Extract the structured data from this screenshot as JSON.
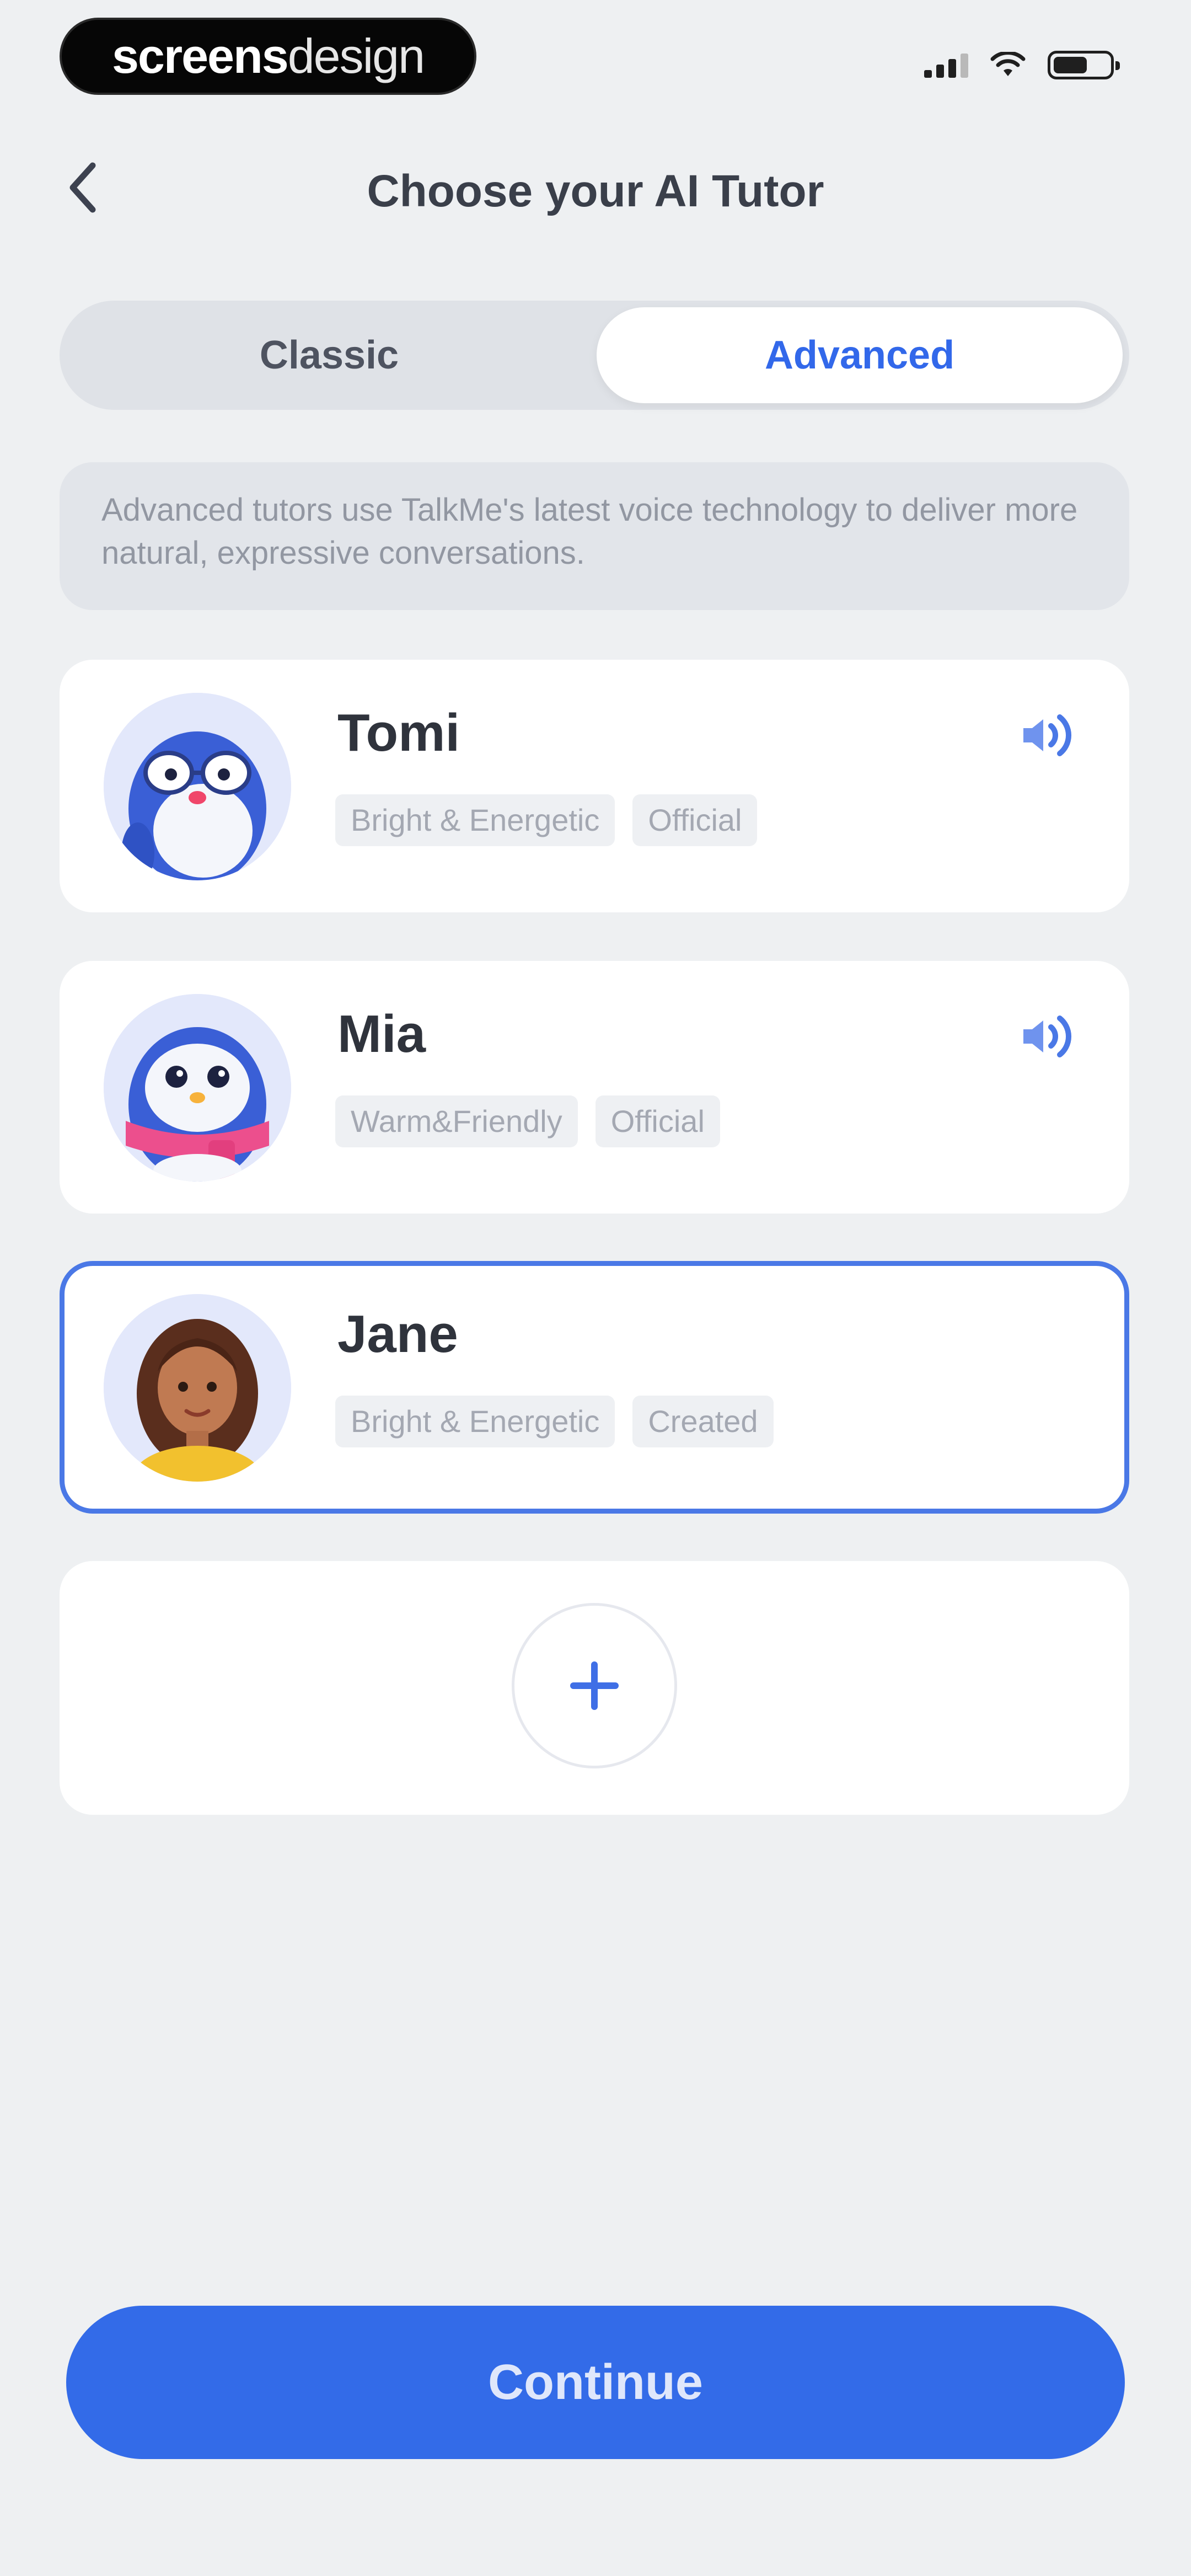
{
  "status_bar": {
    "watermark_bold": "screens",
    "watermark_light": "design",
    "icons": [
      "cellular-signal-icon",
      "wifi-icon",
      "battery-icon"
    ],
    "battery_level": 0.55
  },
  "header": {
    "title": "Choose your AI Tutor",
    "back_icon": "chevron-left-icon"
  },
  "segmented_control": {
    "options": [
      "Classic",
      "Advanced"
    ],
    "selected": "Advanced"
  },
  "info_text": "Advanced tutors use TalkMe's latest voice technology to deliver more natural, expressive conversations.",
  "tutors": [
    {
      "name": "Tomi",
      "tags": [
        "Bright & Energetic",
        "Official"
      ],
      "has_voice_preview": true,
      "selected": false,
      "avatar": "penguin-glasses"
    },
    {
      "name": "Mia",
      "tags": [
        "Warm&Friendly",
        "Official"
      ],
      "has_voice_preview": true,
      "selected": false,
      "avatar": "penguin-scarf"
    },
    {
      "name": "Jane",
      "tags": [
        "Bright & Energetic",
        "Created"
      ],
      "has_voice_preview": false,
      "selected": true,
      "avatar": "woman-curly-hair"
    }
  ],
  "add_tutor_icon": "plus-icon",
  "continue_label": "Continue",
  "colors": {
    "accent": "#336be8",
    "background": "#eef0f2",
    "card": "#ffffff",
    "selected_border": "#4a78e6",
    "tag_background": "#eef0f3",
    "tag_text": "#a4a8b2"
  }
}
